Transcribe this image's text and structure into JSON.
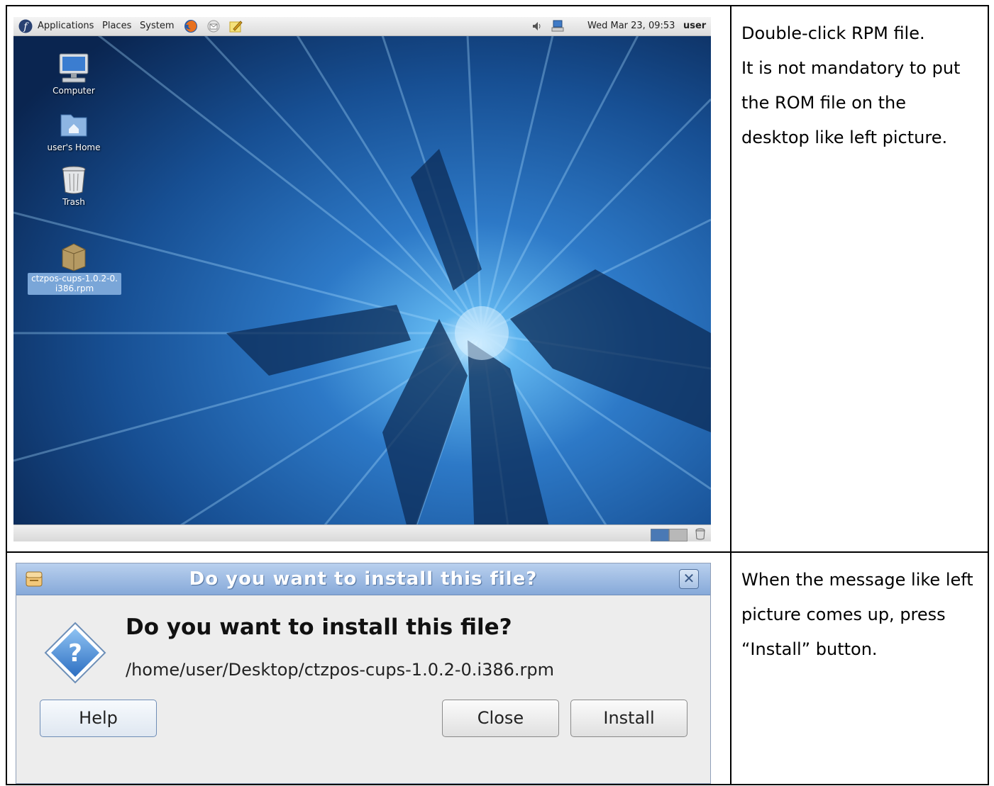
{
  "desktop": {
    "menu": {
      "applications": "Applications",
      "places": "Places",
      "system": "System"
    },
    "clock": "Wed Mar 23, 09:53",
    "user": "user",
    "icons": [
      {
        "label": "Computer"
      },
      {
        "label": "user's Home"
      },
      {
        "label": "Trash"
      },
      {
        "label_line1": "ctzpos-cups-1.0.2-0.",
        "label_line2": "i386.rpm"
      }
    ]
  },
  "notes": {
    "step1": [
      "Double-click RPM file.",
      "It is not mandatory to put",
      "the ROM file on the",
      "desktop like left picture."
    ],
    "step2": [
      "When the message like left",
      "picture comes up, press",
      "“Install” button."
    ]
  },
  "dialog": {
    "title": "Do you want to install this file?",
    "heading": "Do you want to install this file?",
    "path": "/home/user/Desktop/ctzpos-cups-1.0.2-0.i386.rpm",
    "buttons": {
      "help": "Help",
      "close": "Close",
      "install": "Install"
    }
  },
  "colors": {
    "wallpaper_dark": "#0b2a55",
    "wallpaper_light": "#8fd0ff",
    "dialog_title": "#86a9d9"
  }
}
